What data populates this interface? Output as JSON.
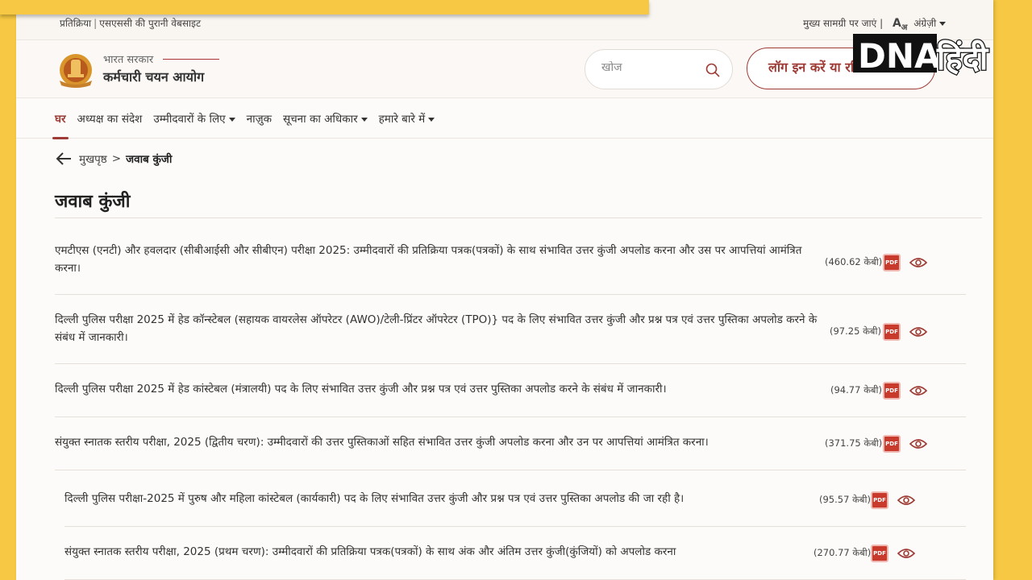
{
  "topbar": {
    "feedback": "प्रतिक्रिया",
    "old_site": "एसएससी की पुरानी वेबसाइट",
    "skip_to_main": "मुख्य सामग्री पर जाएं",
    "font_control": "A",
    "font_control_sub": "अ",
    "language": "अंग्रेज़ी"
  },
  "header": {
    "gov_label": "भारत सरकार",
    "org_name": "कर्मचारी चयन आयोग",
    "search_placeholder": "खोज",
    "login_label": "लॉग इन करें या रजिस्टर करें"
  },
  "nav": {
    "items": [
      {
        "label": "घर",
        "active": true,
        "dropdown": false
      },
      {
        "label": "अध्यक्ष का संदेश",
        "active": false,
        "dropdown": false
      },
      {
        "label": "उम्मीदवारों के लिए",
        "active": false,
        "dropdown": true
      },
      {
        "label": "नाज़ुक",
        "active": false,
        "dropdown": false
      },
      {
        "label": "सूचना का अधिकार",
        "active": false,
        "dropdown": true
      },
      {
        "label": "हमारे बारे में",
        "active": false,
        "dropdown": true
      }
    ]
  },
  "breadcrumb": {
    "home": "मुखपृष्ठ",
    "separator": ">",
    "current": "जवाब कुंजी"
  },
  "page_title": "जवाब कुंजी",
  "notices": [
    {
      "text": "एमटीएस (एनटी) और हवलदार (सीबीआईसी और सीबीएन) परीक्षा 2025: उम्मीदवारों की प्रतिक्रिया पत्रक(पत्रकों) के साथ संभावित उत्तर कुंजी अपलोड करना और उस पर आपत्तियां आमंत्रित करना।",
      "size": "(460.62 केबी)",
      "pdf": "PDF"
    },
    {
      "text": "दिल्ली पुलिस परीक्षा 2025 में हेड कॉन्स्टेबल (सहायक वायरलेस ऑपरेटर (AWO)/टेली-प्रिंटर ऑपरेटर (TPO)} पद के लिए संभावित उत्तर कुंजी और प्रश्न पत्र एवं उत्तर पुस्तिका अपलोड करने के संबंध में जानकारी।",
      "size": "(97.25 केबी)",
      "pdf": "PDF"
    },
    {
      "text": "दिल्ली पुलिस परीक्षा 2025 में हेड कांस्टेबल (मंत्रालयी) पद के लिए संभावित उत्तर कुंजी और प्रश्न पत्र एवं उत्तर पुस्तिका अपलोड करने के संबंध में जानकारी।",
      "size": "(94.77 केबी)",
      "pdf": "PDF"
    },
    {
      "text": "संयुक्त स्नातक स्तरीय परीक्षा, 2025 (द्वितीय चरण): उम्मीदवारों की उत्तर पुस्तिकाओं सहित संभावित उत्तर कुंजी अपलोड करना और उन पर आपत्तियां आमंत्रित करना।",
      "size": "(371.75 केबी)",
      "pdf": "PDF"
    },
    {
      "text": "दिल्ली पुलिस परीक्षा-2025 में पुरुष और महिला कांस्टेबल (कार्यकारी) पद के लिए संभावित उत्तर कुंजी और प्रश्न पत्र एवं उत्तर पुस्तिका अपलोड की जा रही है।",
      "size": "(95.57 केबी)",
      "pdf": "PDF"
    },
    {
      "text": "संयुक्त स्नातक स्तरीय परीक्षा, 2025 (प्रथम चरण): उम्मीदवारों की प्रतिक्रिया पत्रक(पत्रकों) के साथ अंक और अंतिम उत्तर कुंजी(कुंजियों) को अपलोड करना",
      "size": "(270.77 केबी)",
      "pdf": "PDF"
    }
  ],
  "watermark": {
    "brand": "DNA",
    "brand_hindi": "हिंदी"
  },
  "colors": {
    "accent": "#9e3b34",
    "frame": "#f6c843",
    "pdf_red": "#c73a2c"
  }
}
